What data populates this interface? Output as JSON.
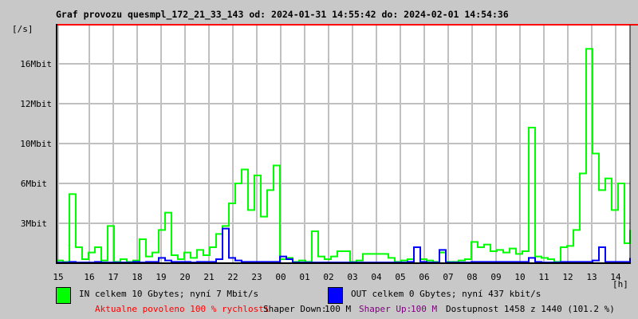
{
  "title": "Graf provozu quesmpl_172_21_33_143 od: 2024-01-31 14:55:42 do: 2024-02-01 14:54:36",
  "chart_data": {
    "type": "line",
    "title": "Graf provozu quesmpl_172_21_33_143 od: 2024-01-31 14:55:42 do: 2024-02-01 14:54:36",
    "ylabel": "[/s]",
    "xlabel": "[h]",
    "y_ticks": [
      {
        "value": 3,
        "label": "3Mbit"
      },
      {
        "value": 6,
        "label": "6Mbit"
      },
      {
        "value": 10,
        "label": "10Mbit"
      },
      {
        "value": 12,
        "label": "12Mbit"
      },
      {
        "value": 16,
        "label": "16Mbit"
      }
    ],
    "x_ticks": [
      "15",
      "16",
      "17",
      "18",
      "19",
      "20",
      "21",
      "22",
      "23",
      "00",
      "01",
      "02",
      "03",
      "04",
      "05",
      "06",
      "07",
      "08",
      "09",
      "10",
      "11",
      "12",
      "13",
      "14"
    ],
    "xlim_hours": [
      0,
      24
    ],
    "grid": true,
    "limit_line_color": "#ff0000",
    "series": [
      {
        "name": "IN",
        "color": "#00ff00",
        "unit": "Mbit/s",
        "values": [
          0.2,
          0.1,
          5.2,
          1.2,
          0.3,
          0.8,
          1.2,
          0.2,
          2.8,
          0.1,
          0.3,
          0.1,
          0.2,
          1.8,
          0.5,
          0.8,
          2.5,
          3.8,
          0.6,
          0.3,
          0.8,
          0.4,
          1.0,
          0.6,
          1.2,
          2.2,
          2.8,
          4.5,
          6.0,
          7.4,
          4.0,
          6.8,
          3.5,
          5.5,
          7.8,
          0.3,
          0.4,
          0.1,
          0.2,
          0.1,
          2.4,
          0.5,
          0.3,
          0.5,
          0.9,
          0.9,
          0.1,
          0.2,
          0.7,
          0.7,
          0.7,
          0.7,
          0.4,
          0.1,
          0.2,
          0.3,
          1.2,
          0.3,
          0.2,
          0.1,
          0.8,
          0.1,
          0.1,
          0.2,
          0.3,
          1.6,
          1.2,
          1.4,
          0.9,
          1.0,
          0.8,
          1.1,
          0.7,
          0.9,
          10.8,
          0.5,
          0.4,
          0.3,
          0.1,
          1.2,
          1.3,
          2.5,
          7.0,
          17.5,
          9.0,
          5.5,
          6.5,
          4.0,
          6.0,
          1.5,
          2.5
        ]
      },
      {
        "name": "OUT",
        "color": "#0000ff",
        "unit": "Mbit/s",
        "values": [
          0.05,
          0.05,
          0.1,
          0.05,
          0.05,
          0.05,
          0.1,
          0.05,
          0.05,
          0.05,
          0.05,
          0.05,
          0.1,
          0.05,
          0.1,
          0.1,
          0.4,
          0.2,
          0.1,
          0.1,
          0.1,
          0.05,
          0.1,
          0.1,
          0.1,
          0.3,
          2.6,
          0.4,
          0.2,
          0.1,
          0.1,
          0.1,
          0.1,
          0.1,
          0.1,
          0.5,
          0.3,
          0.05,
          0.05,
          0.05,
          0.05,
          0.05,
          0.05,
          0.05,
          0.05,
          0.05,
          0.05,
          0.05,
          0.05,
          0.05,
          0.05,
          0.05,
          0.05,
          0.05,
          0.05,
          0.1,
          1.2,
          0.1,
          0.05,
          0.05,
          1.0,
          0.05,
          0.05,
          0.05,
          0.05,
          0.1,
          0.1,
          0.1,
          0.1,
          0.1,
          0.1,
          0.1,
          0.1,
          0.1,
          0.4,
          0.1,
          0.05,
          0.05,
          0.05,
          0.1,
          0.1,
          0.1,
          0.1,
          0.1,
          0.2,
          1.2,
          0.1,
          0.1,
          0.1,
          0.1,
          0.4
        ]
      }
    ]
  },
  "legend": {
    "in_text": "IN celkem 10 Gbytes; nyní 7 Mbit/s",
    "out_text": "OUT celkem 0 Gbytes; nyní 437 kbit/s",
    "in_color": "#00ff00",
    "out_color": "#0000ff"
  },
  "status": {
    "allowed": "Aktualne povoleno 100 % rychlosti",
    "shaper_down_label": "Shaper Down:",
    "shaper_down_value": "100 M",
    "shaper_up_label": "Shaper Up:",
    "shaper_up_value": "100 M",
    "availability": "Dostupnost 1458 z 1440 (101.2 %)"
  }
}
